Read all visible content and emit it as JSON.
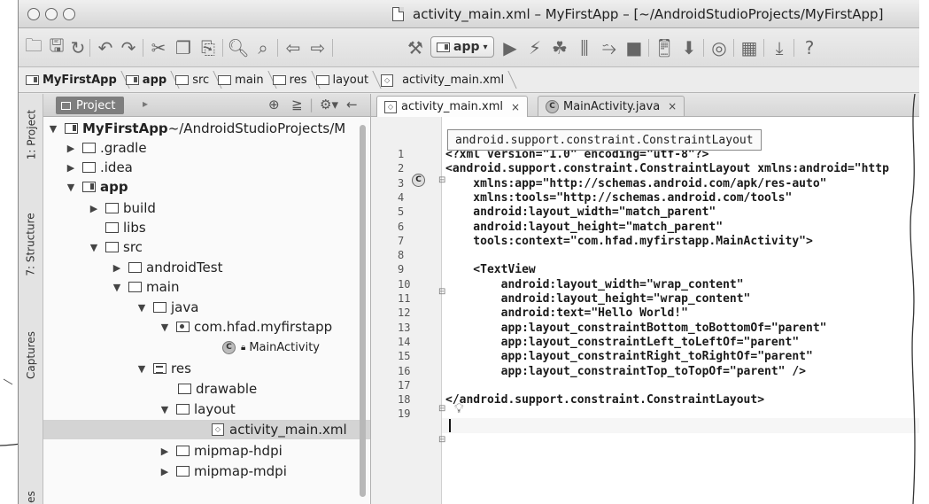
{
  "window": {
    "title": "activity_main.xml – MyFirstApp – [~/AndroidStudioProjects/MyFirstApp]"
  },
  "toolbar": {
    "run_config_label": "app",
    "icons": [
      "open-folder-icon",
      "save-icon",
      "sync-icon",
      "undo-icon",
      "redo-icon",
      "cut-icon",
      "copy-icon",
      "paste-icon",
      "find-icon",
      "replace-icon",
      "back-icon",
      "forward-icon",
      "build-hammer-icon",
      "run-icon",
      "apply-changes-icon",
      "debug-icon",
      "profile-icon",
      "attach-debugger-icon",
      "stop-icon",
      "avd-manager-icon",
      "sdk-manager-icon",
      "device-monitor-icon",
      "project-structure-icon",
      "help-icon"
    ]
  },
  "breadcrumb": {
    "items": [
      "MyFirstApp",
      "app",
      "src",
      "main",
      "res",
      "layout",
      "activity_main.xml"
    ]
  },
  "toolstrip": {
    "tabs": [
      "1: Project",
      "7: Structure",
      "Captures",
      "es"
    ]
  },
  "project_panel": {
    "tab_label": "Project",
    "rows": [
      {
        "label": "MyFirstApp",
        "suffix": " ~/AndroidStudioProjects/M"
      },
      {
        "label": ".gradle"
      },
      {
        "label": ".idea"
      },
      {
        "label": "app"
      },
      {
        "label": "build"
      },
      {
        "label": "libs"
      },
      {
        "label": "src"
      },
      {
        "label": "androidTest"
      },
      {
        "label": "main"
      },
      {
        "label": "java"
      },
      {
        "label": "com.hfad.myfirstapp"
      },
      {
        "label": "MainActivity"
      },
      {
        "label": "res"
      },
      {
        "label": "drawable"
      },
      {
        "label": "layout"
      },
      {
        "label": "activity_main.xml"
      },
      {
        "label": "mipmap-hdpi"
      },
      {
        "label": "mipmap-mdpi"
      }
    ]
  },
  "editor": {
    "tabs": [
      {
        "label": "activity_main.xml",
        "close": "×"
      },
      {
        "label": "MainActivity.java",
        "close": "×"
      }
    ],
    "breadcrumb_popup": "android.support.constraint.ConstraintLayout",
    "line_numbers": [
      "1",
      "2",
      "3",
      "4",
      "5",
      "6",
      "7",
      "8",
      "9",
      "10",
      "11",
      "12",
      "13",
      "14",
      "15",
      "16",
      "17",
      "18",
      "19"
    ],
    "lines": [
      "<?xml version=\"1.0\" encoding=\"utf-8\"?>",
      "<android.support.constraint.ConstraintLayout xmlns:android=\"http",
      "    xmlns:app=\"http://schemas.android.com/apk/res-auto\"",
      "    xmlns:tools=\"http://schemas.android.com/tools\"",
      "    android:layout_width=\"match_parent\"",
      "    android:layout_height=\"match_parent\"",
      "    tools:context=\"com.hfad.myfirstapp.MainActivity\">",
      "",
      "    <TextView",
      "        android:layout_width=\"wrap_content\"",
      "        android:layout_height=\"wrap_content\"",
      "        android:text=\"Hello World!\"",
      "        app:layout_constraintBottom_toBottomOf=\"parent\"",
      "        app:layout_constraintLeft_toLeftOf=\"parent\"",
      "        app:layout_constraintRight_toRightOf=\"parent\"",
      "        app:layout_constraintTop_toTopOf=\"parent\" />",
      "",
      "</android.support.constraint.ConstraintLayout>",
      ""
    ]
  }
}
